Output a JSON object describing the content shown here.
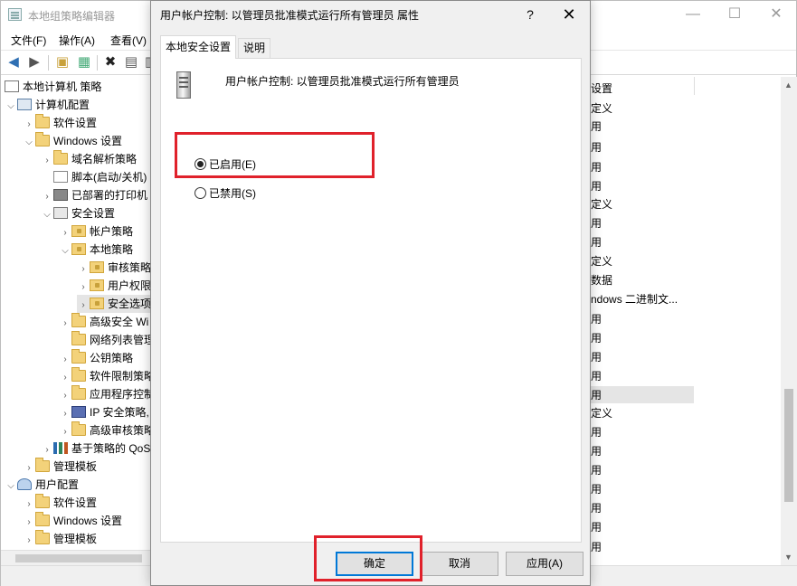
{
  "main_window": {
    "title": "本地组策略编辑器",
    "controls": {
      "minimize": "—",
      "maximize": "☐",
      "close": "✕"
    },
    "menu": [
      "文件(F)",
      "操作(A)",
      "查看(V)"
    ]
  },
  "toolbar": {
    "icons": [
      "back-arrow-icon",
      "forward-arrow-icon",
      "up-folder-icon",
      "show-hide-tree-icon",
      "delete-icon",
      "properties-icon",
      "export-icon"
    ]
  },
  "tree": {
    "root": "本地计算机 策略",
    "computer_config": "计算机配置",
    "software_settings": "软件设置",
    "windows_settings": "Windows 设置",
    "name_resolution": "域名解析策略",
    "scripts": "脚本(启动/关机)",
    "printers": "已部署的打印机",
    "security_settings": "安全设置",
    "account_policies": "帐户策略",
    "local_policies": "本地策略",
    "audit_policy": "审核策略",
    "user_rights": "用户权限",
    "security_options": "安全选项",
    "advanced_firewall": "高级安全 Wi",
    "network_list": "网络列表管理",
    "public_key": "公钥策略",
    "software_restriction": "软件限制策略",
    "app_control": "应用程序控制",
    "ip_security": "IP 安全策略,",
    "advanced_audit": "高级审核策略",
    "qos": "基于策略的 QoS",
    "admin_templates": "管理模板",
    "user_config": "用户配置",
    "u_software_settings": "软件设置",
    "u_windows_settings": "Windows 设置",
    "u_admin_templates": "管理模板"
  },
  "right_pane": {
    "items": [
      "设置",
      "定义",
      "用",
      "用",
      "用",
      "用",
      "定义",
      "用",
      "用",
      "定义",
      "数据",
      "ndows 二进制文...",
      "用",
      "用",
      "用",
      "用",
      "用",
      "定义",
      "用",
      "用",
      "用",
      "用",
      "用",
      "用",
      "用"
    ]
  },
  "dialog": {
    "title": "用户帐户控制: 以管理员批准模式运行所有管理员 属性",
    "help": "?",
    "close": "✕",
    "tabs": {
      "local": "本地安全设置",
      "explain": "说明"
    },
    "policy_name": "用户帐户控制: 以管理员批准模式运行所有管理员",
    "options": {
      "enabled": "已启用(E)",
      "disabled": "已禁用(S)"
    },
    "selected": "enabled",
    "buttons": {
      "ok": "确定",
      "cancel": "取消",
      "apply": "应用(A)"
    }
  },
  "colors": {
    "annotation": "#e0212b",
    "accent": "#0078d7"
  }
}
